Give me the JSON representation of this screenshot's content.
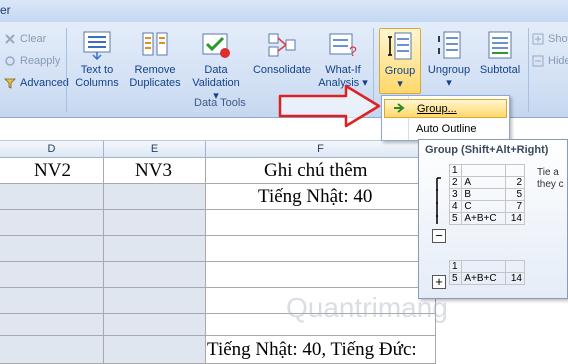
{
  "window": {
    "title_fragment": "er"
  },
  "left_small": {
    "clear": "Clear",
    "reapply": "Reapply",
    "advanced": "Advanced"
  },
  "data_tools": {
    "text_to_columns": [
      "Text to",
      "Columns"
    ],
    "remove_duplicates": [
      "Remove",
      "Duplicates"
    ],
    "data_validation": [
      "Data",
      "Validation ▾"
    ],
    "consolidate": "Consolidate",
    "what_if": [
      "What-If",
      "Analysis ▾"
    ],
    "group_label": "Data Tools"
  },
  "outline": {
    "group": [
      "Group",
      "▾"
    ],
    "ungroup": [
      "Ungroup",
      "▾"
    ],
    "subtotal": "Subtotal",
    "show_detail": "Show",
    "hide_detail": "Hide"
  },
  "sheet": {
    "columns": [
      "D",
      "E",
      "F"
    ],
    "header_row": [
      "NV2",
      "NV3",
      "Ghi chú thêm"
    ],
    "f_row2": "Tiếng Nhật: 40",
    "f_row_last": "Tiếng Nhật: 40, Tiếng Đức:"
  },
  "menu": {
    "items": [
      "Group...",
      "Auto Outline"
    ]
  },
  "tooltip": {
    "title": "Group (Shift+Alt+Right)",
    "desc": [
      "Tie a",
      "they c"
    ],
    "table1": [
      [
        "1",
        "",
        ""
      ],
      [
        "2",
        "A",
        "2"
      ],
      [
        "3",
        "B",
        "5"
      ],
      [
        "4",
        "C",
        "7"
      ],
      [
        "5",
        "A+B+C",
        "14"
      ]
    ],
    "table2": [
      [
        "1",
        "",
        ""
      ],
      [
        "5",
        "A+B+C",
        "14"
      ]
    ]
  },
  "watermark": "Quantrimang"
}
